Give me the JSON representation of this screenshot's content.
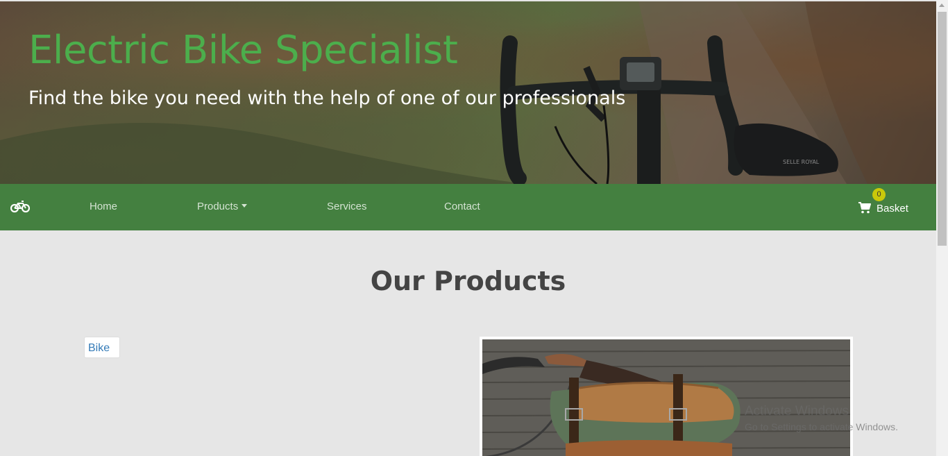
{
  "hero": {
    "title": "Electric Bike Specialist",
    "subtitle": "Find the bike you need with the help of one of our professionals"
  },
  "nav": {
    "brand_icon": "bicycle-icon",
    "links": [
      {
        "label": "Home"
      },
      {
        "label": "Products",
        "dropdown": true
      },
      {
        "label": "Services"
      },
      {
        "label": "Contact"
      }
    ],
    "basket": {
      "label": "Basket",
      "count": "0",
      "icon": "shopping-cart-icon"
    }
  },
  "products": {
    "heading": "Our Products",
    "items": [
      {
        "image_alt": "Bike",
        "image_state": "broken"
      },
      {
        "image_description": "bike-with-saddle-bag-photo"
      }
    ]
  },
  "watermark": {
    "title": "Activate Windows",
    "subtitle": "Go to Settings to activate Windows."
  },
  "colors": {
    "title_green": "#4cae4c",
    "nav_green": "#448040",
    "badge_yellow": "#c9c90a",
    "page_bg": "#e6e6e6",
    "heading_gray": "#444444"
  }
}
